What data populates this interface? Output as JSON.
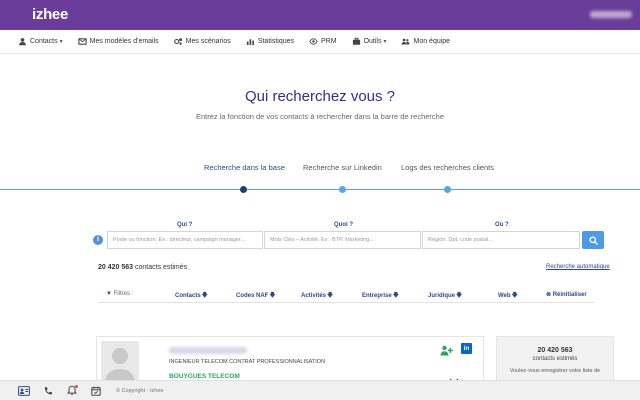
{
  "app": {
    "logo": "izhee"
  },
  "nav": {
    "items": [
      {
        "label": "Contacts",
        "icon": "contacts-icon",
        "dropdown": true
      },
      {
        "label": "Mes modèles d'emails",
        "icon": "email-template-icon",
        "dropdown": false
      },
      {
        "label": "Mes scénarios",
        "icon": "scenarios-icon",
        "dropdown": false
      },
      {
        "label": "Statistiques",
        "icon": "stats-icon",
        "dropdown": false
      },
      {
        "label": "PRM",
        "icon": "eye-icon",
        "dropdown": false
      },
      {
        "label": "Outils",
        "icon": "briefcase-icon",
        "dropdown": true
      },
      {
        "label": "Mon équipe",
        "icon": "team-icon",
        "dropdown": false
      }
    ]
  },
  "hero": {
    "title": "Qui recherchez vous ?",
    "subtitle": "Entrez la fonction de vos contacts à rechercher dans la barre de recherche"
  },
  "tabs": [
    {
      "label": "Recherche dans la base",
      "active": true
    },
    {
      "label": "Recherche sur Linkedin",
      "active": false
    },
    {
      "label": "Logs des recherches clients",
      "active": false
    }
  ],
  "search": {
    "who_label": "Qui ?",
    "who_placeholder": "Poste ou fonction, Ex : directeur, campaign manager...",
    "what_label": "Quoi ?",
    "what_placeholder": "Mots Clés – Activité, Ex : BTP, Marketing...",
    "where_label": "Où ?",
    "where_placeholder": "Région, Dpt, code postal..."
  },
  "results": {
    "count": "20 420 563",
    "count_suffix": "contacts estimés",
    "auto_search": "Recherche automatique"
  },
  "filters": {
    "label": "Filtres :",
    "columns": [
      "Contacts",
      "Codes NAF",
      "Activités",
      "Entreprise",
      "Juridique",
      "Web"
    ],
    "reset": "Réinitialiser"
  },
  "contact_card": {
    "role": "INGENIEUR TELECOM CONTRAT PROFESSIONNALISATION",
    "company": "BOUYGUES TELECOM"
  },
  "side_panel": {
    "count": "20 420 563",
    "label": "contacts estimés",
    "text": "Voulez-vous enregistrer votre liste de"
  },
  "footer": {
    "copyright": "© Copyright - Izhee"
  },
  "colors": {
    "brand": "#6a3d9a",
    "accent": "#4f9be0",
    "heading": "#3d2a8f",
    "link": "#2c4a8a",
    "company": "#2aa55f"
  }
}
